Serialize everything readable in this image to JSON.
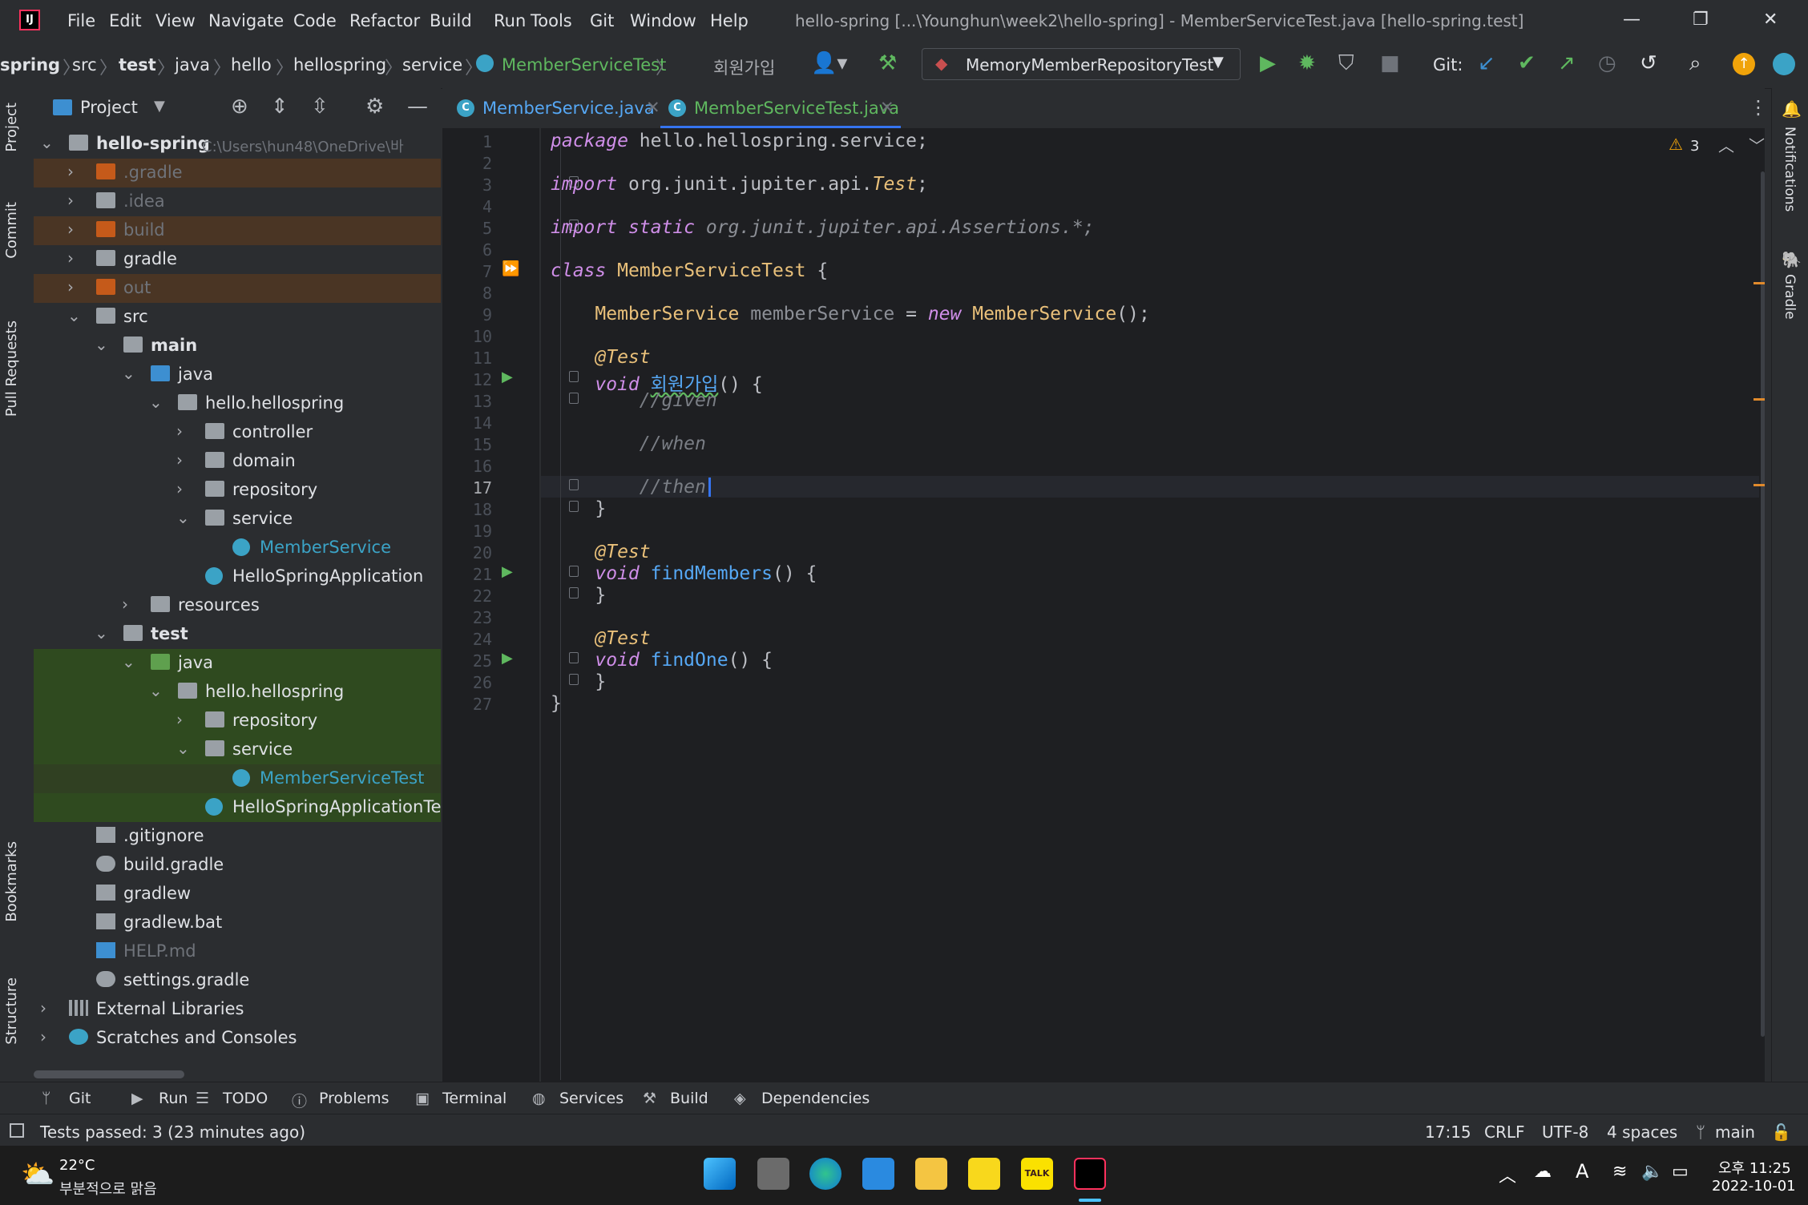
{
  "window": {
    "title": "hello-spring [...\\Younghun\\week2\\hello-spring] - MemberServiceTest.java [hello-spring.test]",
    "menu": [
      "File",
      "Edit",
      "View",
      "Navigate",
      "Code",
      "Refactor",
      "Build",
      "Run",
      "Tools",
      "Git",
      "Window",
      "Help"
    ]
  },
  "navbar": {
    "breadcrumbs": [
      "spring",
      "src",
      "test",
      "java",
      "hello",
      "hellospring",
      "service",
      "MemberServiceTest"
    ],
    "method_crumb": "회원가입",
    "run_config": "MemoryMemberRepositoryTest",
    "git_label": "Git:"
  },
  "left_strip": [
    "Project",
    "Commit",
    "Pull Requests",
    "Bookmarks",
    "Structure"
  ],
  "right_strip": [
    "Notifications",
    "Gradle"
  ],
  "project": {
    "title": "Project",
    "root_name": "hello-spring",
    "root_path": "C:\\Users\\hun48\\OneDrive\\바",
    "items": [
      {
        "label": ".gradle",
        "depth": 1,
        "chev": ">",
        "icon": "folder-orange",
        "dim": true,
        "bg": "excluded"
      },
      {
        "label": ".idea",
        "depth": 1,
        "chev": ">",
        "icon": "folder",
        "dim": true,
        "bg": ""
      },
      {
        "label": "build",
        "depth": 1,
        "chev": ">",
        "icon": "folder-orange",
        "dim": true,
        "bg": "excluded"
      },
      {
        "label": "gradle",
        "depth": 1,
        "chev": ">",
        "icon": "folder",
        "dim": false,
        "bg": ""
      },
      {
        "label": "out",
        "depth": 1,
        "chev": ">",
        "icon": "folder-orange",
        "dim": true,
        "bg": "excluded"
      },
      {
        "label": "src",
        "depth": 1,
        "chev": "v",
        "icon": "folder",
        "dim": false,
        "bg": ""
      },
      {
        "label": "main",
        "depth": 2,
        "chev": "v",
        "icon": "folder",
        "dim": false,
        "bg": "",
        "bold": true
      },
      {
        "label": "java",
        "depth": 3,
        "chev": "v",
        "icon": "folder-blue",
        "dim": false,
        "bg": ""
      },
      {
        "label": "hello.hellospring",
        "depth": 4,
        "chev": "v",
        "icon": "package",
        "dim": false,
        "bg": ""
      },
      {
        "label": "controller",
        "depth": 5,
        "chev": ">",
        "icon": "package",
        "dim": false,
        "bg": ""
      },
      {
        "label": "domain",
        "depth": 5,
        "chev": ">",
        "icon": "package",
        "dim": false,
        "bg": ""
      },
      {
        "label": "repository",
        "depth": 5,
        "chev": ">",
        "icon": "package",
        "dim": false,
        "bg": ""
      },
      {
        "label": "service",
        "depth": 5,
        "chev": "v",
        "icon": "package",
        "dim": false,
        "bg": ""
      },
      {
        "label": "MemberService",
        "depth": 6,
        "chev": "",
        "icon": "class",
        "dim": false,
        "bg": "",
        "link": true
      },
      {
        "label": "HelloSpringApplication",
        "depth": 5,
        "chev": "",
        "icon": "class",
        "dim": false,
        "bg": ""
      },
      {
        "label": "resources",
        "depth": 3,
        "chev": ">",
        "icon": "folder",
        "dim": false,
        "bg": ""
      },
      {
        "label": "test",
        "depth": 2,
        "chev": "v",
        "icon": "folder",
        "dim": false,
        "bg": "",
        "bold": true
      },
      {
        "label": "java",
        "depth": 3,
        "chev": "v",
        "icon": "folder-green",
        "dim": false,
        "bg": "test"
      },
      {
        "label": "hello.hellospring",
        "depth": 4,
        "chev": "v",
        "icon": "package",
        "dim": false,
        "bg": "test"
      },
      {
        "label": "repository",
        "depth": 5,
        "chev": ">",
        "icon": "package",
        "dim": false,
        "bg": "test"
      },
      {
        "label": "service",
        "depth": 5,
        "chev": "v",
        "icon": "package",
        "dim": false,
        "bg": "test"
      },
      {
        "label": "MemberServiceTest",
        "depth": 6,
        "chev": "",
        "icon": "class",
        "dim": false,
        "bg": "test-selected",
        "link": true
      },
      {
        "label": "HelloSpringApplicationTest",
        "depth": 5,
        "chev": "",
        "icon": "class",
        "dim": false,
        "bg": "test"
      },
      {
        "label": ".gitignore",
        "depth": 1,
        "chev": "",
        "icon": "file",
        "dim": false,
        "bg": ""
      },
      {
        "label": "build.gradle",
        "depth": 1,
        "chev": "",
        "icon": "gradle",
        "dim": false,
        "bg": ""
      },
      {
        "label": "gradlew",
        "depth": 1,
        "chev": "",
        "icon": "file",
        "dim": false,
        "bg": ""
      },
      {
        "label": "gradlew.bat",
        "depth": 1,
        "chev": "",
        "icon": "file",
        "dim": false,
        "bg": ""
      },
      {
        "label": "HELP.md",
        "depth": 1,
        "chev": "",
        "icon": "md",
        "dim": true,
        "bg": ""
      },
      {
        "label": "settings.gradle",
        "depth": 1,
        "chev": "",
        "icon": "gradle",
        "dim": false,
        "bg": ""
      },
      {
        "label": "External Libraries",
        "depth": 0,
        "chev": ">",
        "icon": "lib",
        "dim": false,
        "bg": ""
      },
      {
        "label": "Scratches and Consoles",
        "depth": 0,
        "chev": ">",
        "icon": "scratch",
        "dim": false,
        "bg": ""
      }
    ]
  },
  "tabs": [
    {
      "label": "MemberService.java",
      "active": false
    },
    {
      "label": "MemberServiceTest.java",
      "active": true
    }
  ],
  "editor": {
    "warnings": "3",
    "current_line": 17,
    "lines": [
      [
        [
          "kw",
          "package"
        ],
        [
          "t",
          " hello.hellospring.service;"
        ]
      ],
      [],
      [
        [
          "kw",
          "import"
        ],
        [
          "t",
          " org.junit.jupiter.api."
        ],
        [
          "ann",
          "Test"
        ],
        [
          "t",
          ";"
        ]
      ],
      [],
      [
        [
          "kw",
          "import static"
        ],
        [
          "cmtp",
          " org.junit.jupiter.api.Assertions.*;"
        ]
      ],
      [],
      [
        [
          "kw",
          "class"
        ],
        [
          "t",
          " "
        ],
        [
          "typ",
          "MemberServiceTest"
        ],
        [
          "t",
          " {"
        ]
      ],
      [],
      [
        [
          "t",
          "    "
        ],
        [
          "typ",
          "MemberService"
        ],
        [
          "dim",
          " memberService"
        ],
        [
          "t",
          " = "
        ],
        [
          "kw",
          "new"
        ],
        [
          "t",
          " "
        ],
        [
          "typ",
          "MemberService"
        ],
        [
          "t",
          "();"
        ]
      ],
      [],
      [
        [
          "t",
          "    "
        ],
        [
          "ann",
          "@Test"
        ]
      ],
      [
        [
          "t",
          "    "
        ],
        [
          "kw",
          "void"
        ],
        [
          "t",
          " "
        ],
        [
          "fnw",
          "회원가입"
        ],
        [
          "t",
          "() {"
        ]
      ],
      [
        [
          "t",
          "        "
        ],
        [
          "cmt",
          "//given"
        ]
      ],
      [],
      [
        [
          "t",
          "        "
        ],
        [
          "cmt",
          "//when"
        ]
      ],
      [],
      [
        [
          "t",
          "        "
        ],
        [
          "cmt",
          "//then"
        ]
      ],
      [
        [
          "t",
          "    }"
        ]
      ],
      [],
      [
        [
          "t",
          "    "
        ],
        [
          "ann",
          "@Test"
        ]
      ],
      [
        [
          "t",
          "    "
        ],
        [
          "kw",
          "void"
        ],
        [
          "t",
          " "
        ],
        [
          "fn",
          "findMembers"
        ],
        [
          "t",
          "() {"
        ]
      ],
      [
        [
          "t",
          "    }"
        ]
      ],
      [],
      [
        [
          "t",
          "    "
        ],
        [
          "ann",
          "@Test"
        ]
      ],
      [
        [
          "t",
          "    "
        ],
        [
          "kw",
          "void"
        ],
        [
          "t",
          " "
        ],
        [
          "fn",
          "findOne"
        ],
        [
          "t",
          "() {"
        ]
      ],
      [
        [
          "t",
          "    }"
        ]
      ],
      [
        [
          "t",
          "}"
        ]
      ]
    ],
    "run_gutter_lines": [
      7,
      12,
      21,
      25
    ],
    "fold_lines": [
      3,
      5,
      12,
      13,
      17,
      18,
      21,
      22,
      25,
      26
    ]
  },
  "bottom_tools": [
    "Git",
    "Run",
    "TODO",
    "Problems",
    "Terminal",
    "Services",
    "Build",
    "Dependencies"
  ],
  "status": {
    "message": "Tests passed: 3 (23 minutes ago)",
    "position": "17:15",
    "line_sep": "CRLF",
    "encoding": "UTF-8",
    "indent": "4 spaces",
    "branch": "main"
  },
  "taskbar": {
    "temp": "22°C",
    "weather": "부분적으로 맑음",
    "time": "오후 11:25",
    "date": "2022-10-01",
    "ime": "A"
  }
}
